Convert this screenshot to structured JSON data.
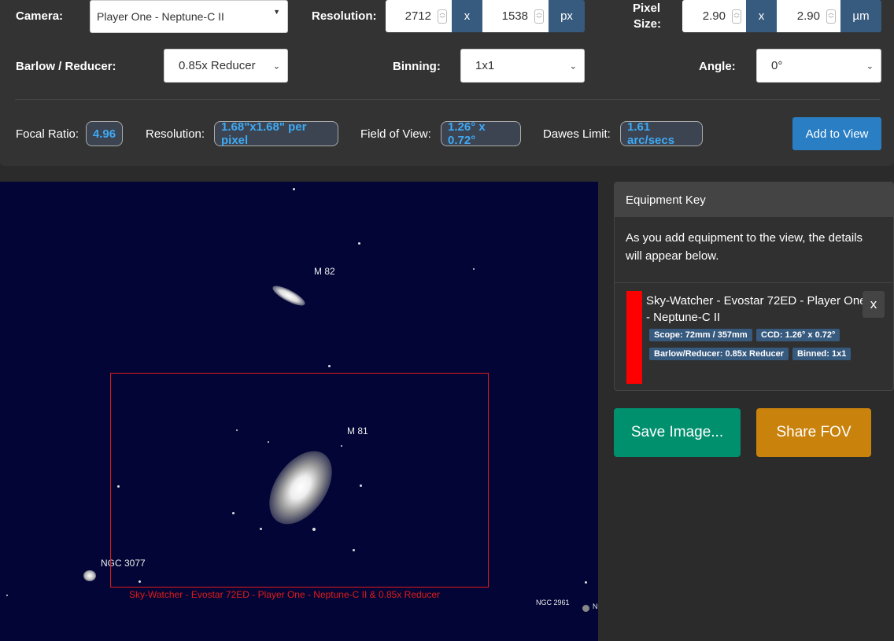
{
  "camera": {
    "label": "Camera:",
    "value": "Player One - Neptune-C II"
  },
  "resolution": {
    "label": "Resolution:",
    "width": "2712",
    "height": "1538",
    "x": "x",
    "unit": "px"
  },
  "pixel_size": {
    "label_line1": "Pixel",
    "label_line2": "Size:",
    "width": "2.90",
    "height": "2.90",
    "x": "x",
    "unit": "µm"
  },
  "barlow": {
    "label": "Barlow / Reducer:",
    "value": "0.85x Reducer"
  },
  "binning": {
    "label": "Binning:",
    "value": "1x1"
  },
  "angle": {
    "label": "Angle:",
    "value": "0°"
  },
  "stats": {
    "focal_ratio_label": "Focal Ratio:",
    "focal_ratio": "4.96",
    "resolution_label": "Resolution:",
    "resolution": "1.68\"x1.68\" per pixel",
    "fov_label": "Field of View:",
    "fov": "1.26° x 0.72°",
    "dawes_label": "Dawes Limit:",
    "dawes": "1.61 arc/secs"
  },
  "add_to_view": "Add to View",
  "sky": {
    "m82": "M 82",
    "m81": "M 81",
    "ngc3077": "NGC 3077",
    "ngc2961": "NGC 2961",
    "ngc_partial": "N",
    "fov_caption": "Sky-Watcher - Evostar 72ED - Player One - Neptune-C II  & 0.85x Reducer"
  },
  "equipment_key": {
    "title": "Equipment Key",
    "description": "As you add equipment to the view, the details will appear below.",
    "item": {
      "name": "Sky-Watcher - Evostar 72ED - Player One - Neptune-C II",
      "color": "#ff0000",
      "scope": "Scope: 72mm / 357mm",
      "ccd": "CCD: 1.26° x 0.72°",
      "barlow": "Barlow/Reducer: 0.85x Reducer",
      "binned": "Binned: 1x1",
      "remove": "x"
    }
  },
  "save_image": "Save Image...",
  "share_fov": "Share FOV",
  "colors": {
    "save": "#00906e",
    "share": "#c9820c",
    "accent": "#375a7f",
    "link_blue": "#3fa9f5"
  }
}
